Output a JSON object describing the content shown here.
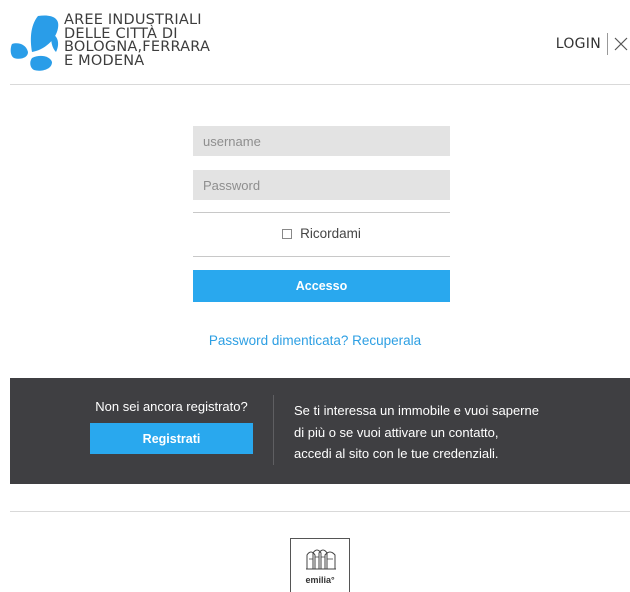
{
  "header": {
    "logo_lines": [
      "AREE INDUSTRIALI",
      "DELLE CITTÀ DI",
      "BOLOGNA,FERRARA",
      "E MODENA"
    ],
    "login_label": "LOGIN",
    "close_icon": "close-icon"
  },
  "form": {
    "username_placeholder": "username",
    "password_placeholder": "Password",
    "remember_label": "Ricordami",
    "submit_label": "Accesso",
    "forgot_link": "Password dimenticata? Recuperala"
  },
  "register": {
    "question": "Non sei ancora registrato?",
    "button_label": "Registrati",
    "info_lines": [
      "Se ti interessa un immobile e vuoi saperne",
      "di più o se vuoi attivare un contatto,",
      "accedi al sito con le tue credenziali."
    ]
  },
  "footer": {
    "badge_label": "emilia°"
  },
  "colors": {
    "accent": "#29a8ee",
    "link": "#2d9fe3",
    "dark_band": "#3f3f42",
    "input_bg": "#e3e3e3"
  }
}
